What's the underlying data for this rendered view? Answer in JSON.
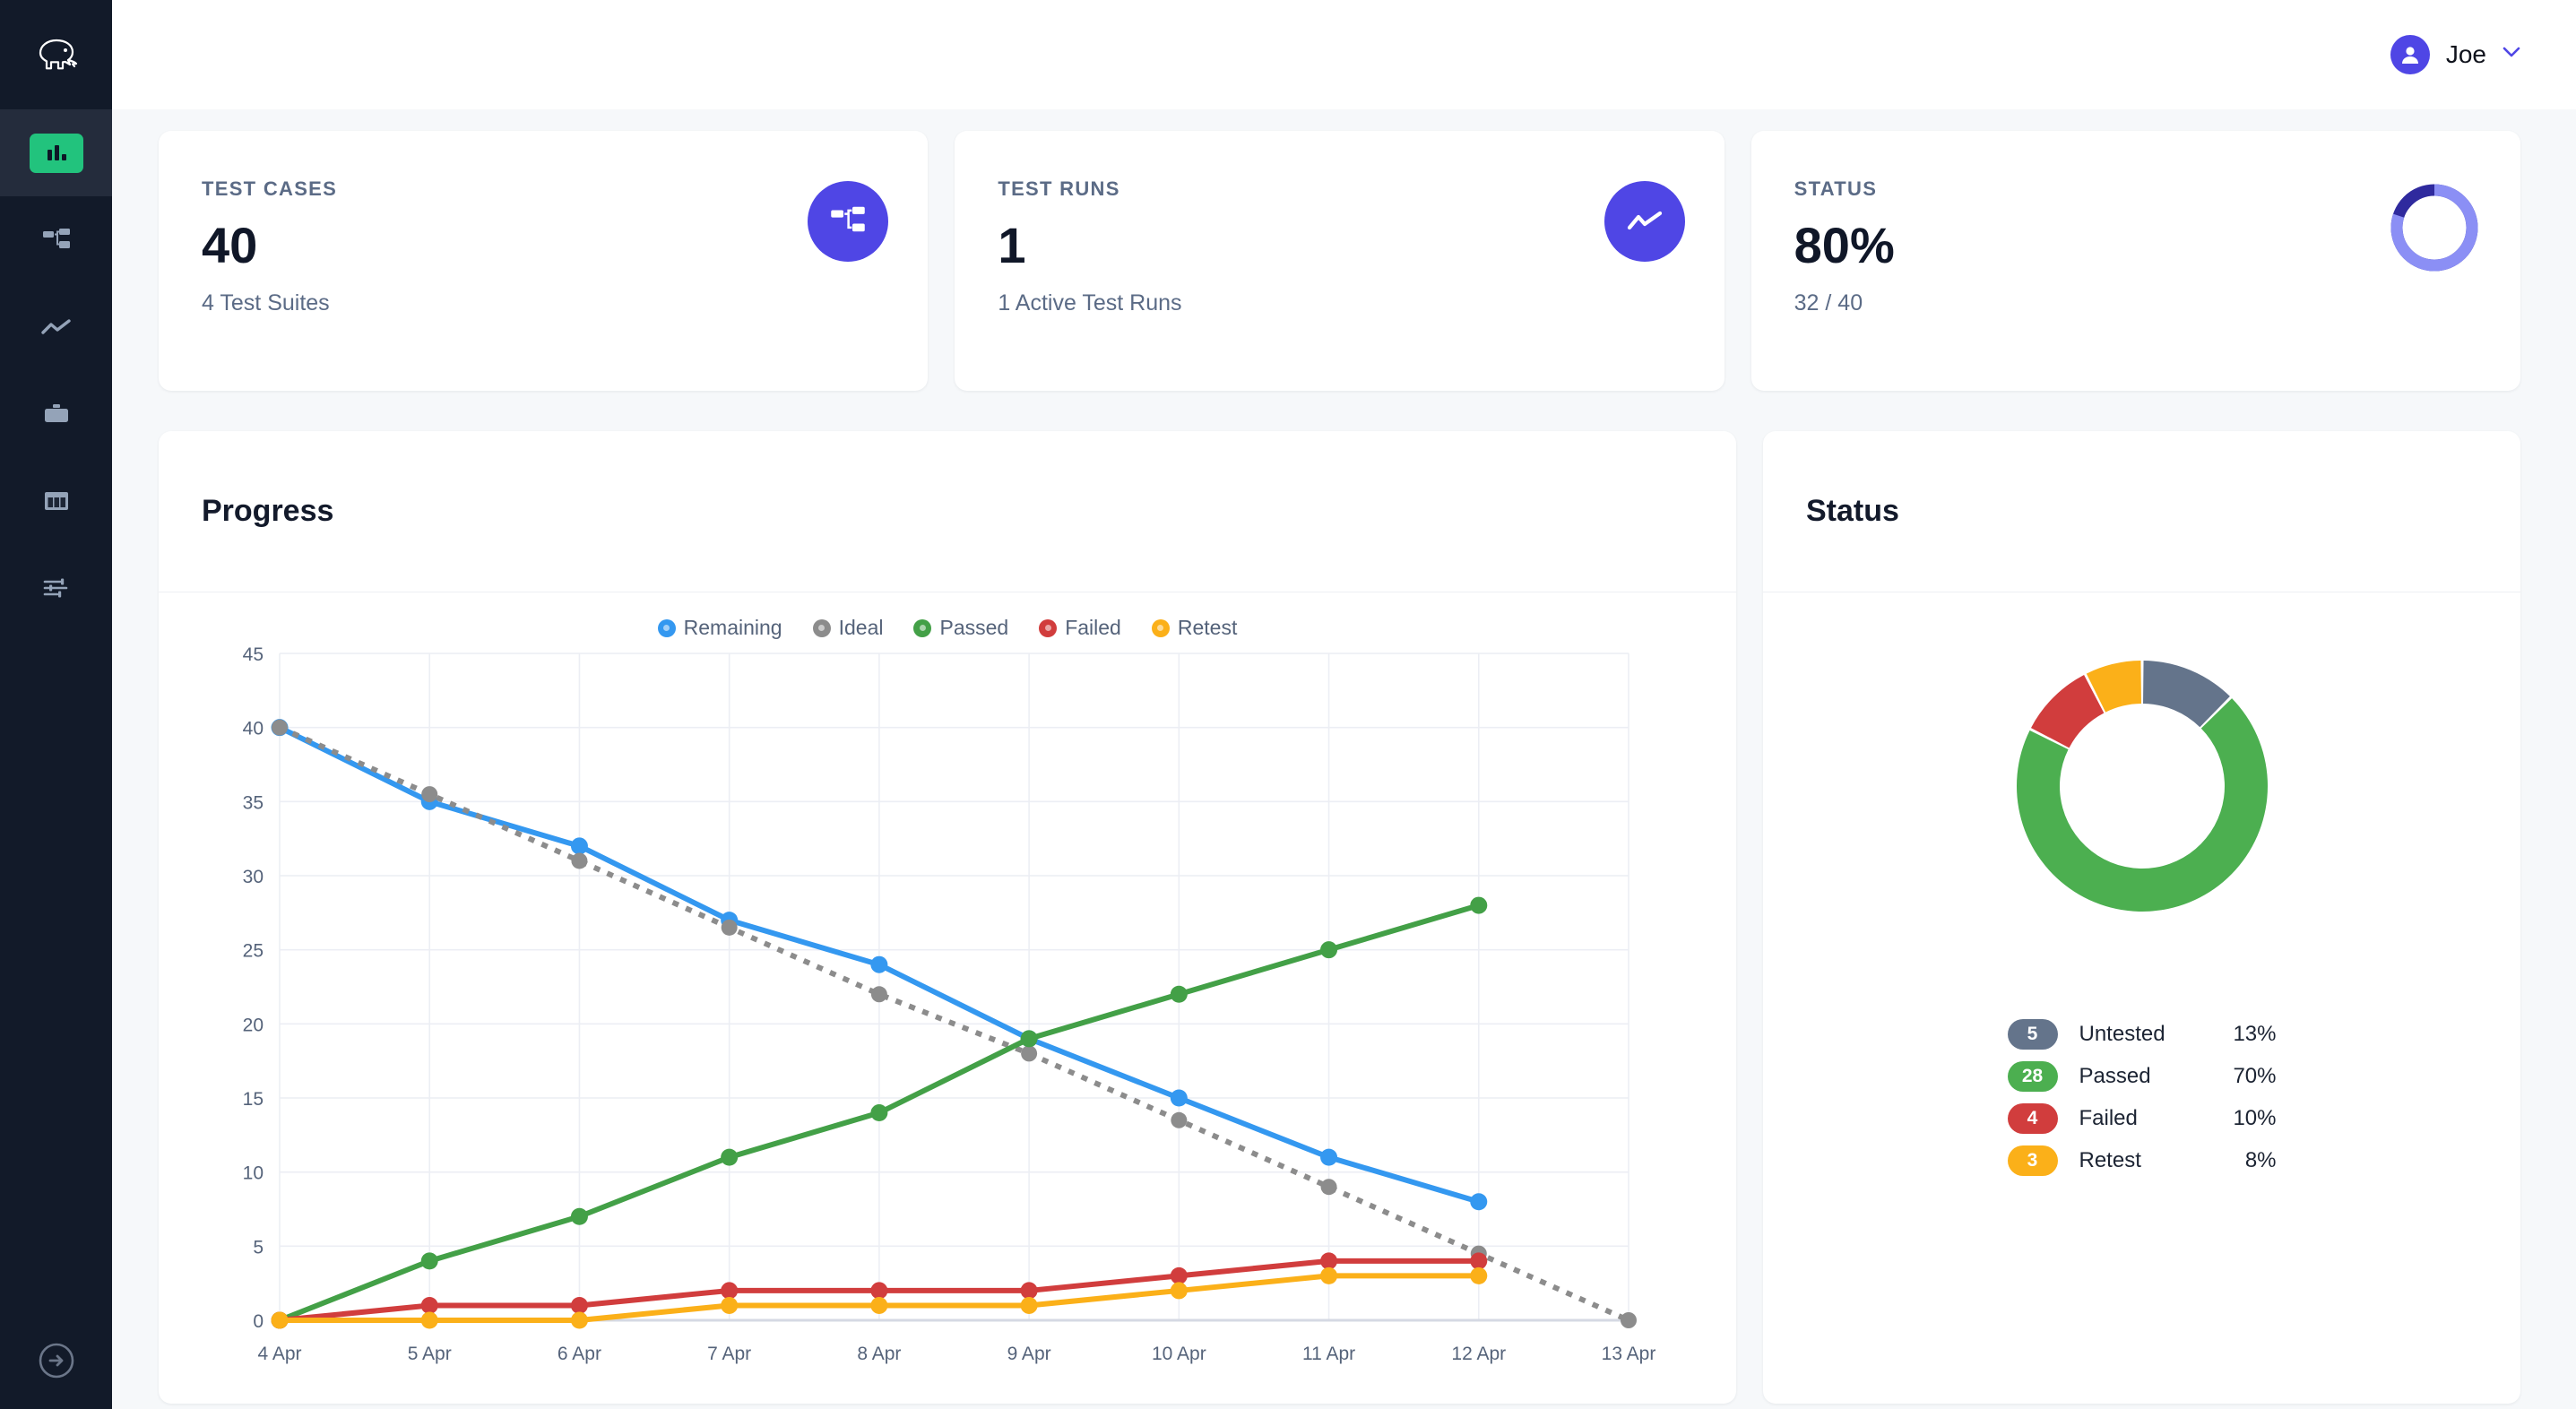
{
  "app": {
    "logo_icon": "elephant-logo-icon",
    "sidebar_toggle_icon": "arrow-right-circle-icon"
  },
  "sidebar": {
    "items": [
      {
        "icon": "bar-chart-icon",
        "name": "dashboard",
        "active": true
      },
      {
        "icon": "sitemap-icon",
        "name": "test-cases",
        "active": false
      },
      {
        "icon": "trend-line-icon",
        "name": "test-runs",
        "active": false
      },
      {
        "icon": "briefcase-icon",
        "name": "projects",
        "active": false
      },
      {
        "icon": "columns-icon",
        "name": "boards",
        "active": false
      },
      {
        "icon": "sliders-icon",
        "name": "settings",
        "active": false
      }
    ]
  },
  "topbar": {
    "user_name": "Joe",
    "avatar_icon": "user-avatar-icon",
    "chevron_icon": "chevron-down-icon"
  },
  "stat_cards": [
    {
      "label": "TEST CASES",
      "value": "40",
      "sub": "4 Test Suites",
      "icon": "sitemap-icon",
      "badge_color": "#4f46e5"
    },
    {
      "label": "TEST RUNS",
      "value": "1",
      "sub": "1 Active Test Runs",
      "icon": "activity-line-icon",
      "badge_color": "#4f46e5"
    },
    {
      "label": "STATUS",
      "value": "80%",
      "sub": "32 / 40",
      "icon": "progress-ring-icon",
      "ring_percent": 80,
      "ring_color": "#8b8ff5",
      "ring_track_color": "#2f2a9e"
    }
  ],
  "progress_panel": {
    "title": "Progress"
  },
  "status_panel": {
    "title": "Status",
    "legend": [
      {
        "count": "5",
        "label": "Untested",
        "pct": "13%",
        "color": "#64748b"
      },
      {
        "count": "28",
        "label": "Passed",
        "pct": "70%",
        "color": "#4caf50"
      },
      {
        "count": "4",
        "label": "Failed",
        "pct": "10%",
        "color": "#d13d3d"
      },
      {
        "count": "3",
        "label": "Retest",
        "pct": "8%",
        "color": "#fbb019"
      }
    ]
  },
  "chart_data": [
    {
      "type": "line",
      "title": "Progress",
      "xlabel": "",
      "ylabel": "",
      "x": [
        "4 Apr",
        "5 Apr",
        "6 Apr",
        "7 Apr",
        "8 Apr",
        "9 Apr",
        "10 Apr",
        "11 Apr",
        "12 Apr",
        "13 Apr"
      ],
      "ylim": [
        0,
        45
      ],
      "ytick_step": 5,
      "yticks": [
        0,
        5,
        10,
        15,
        20,
        25,
        30,
        35,
        40,
        45
      ],
      "grid": true,
      "legend_position": "top-center",
      "series": [
        {
          "name": "Remaining",
          "color": "#3498f0",
          "style": "solid",
          "values": [
            40,
            35,
            32,
            27,
            24,
            19,
            15,
            11,
            8,
            null
          ]
        },
        {
          "name": "Ideal",
          "color": "#8c8c8c",
          "style": "dotted",
          "values": [
            40,
            35.5,
            31,
            26.5,
            22,
            18,
            13.5,
            9,
            4.5,
            0
          ]
        },
        {
          "name": "Passed",
          "color": "#43a047",
          "style": "solid",
          "values": [
            0,
            4,
            7,
            11,
            14,
            19,
            22,
            25,
            28,
            null
          ]
        },
        {
          "name": "Failed",
          "color": "#d13d3d",
          "style": "solid",
          "values": [
            0,
            1,
            1,
            2,
            2,
            2,
            3,
            4,
            4,
            null
          ]
        },
        {
          "name": "Retest",
          "color": "#fbb019",
          "style": "solid",
          "values": [
            0,
            0,
            0,
            1,
            1,
            1,
            2,
            3,
            3,
            null
          ]
        }
      ]
    },
    {
      "type": "pie",
      "title": "Status",
      "donut": true,
      "labels": [
        "Untested",
        "Passed",
        "Failed",
        "Retest"
      ],
      "values": [
        5,
        28,
        4,
        3
      ],
      "percents": [
        13,
        70,
        10,
        8
      ],
      "colors": [
        "#64748b",
        "#4caf50",
        "#d13d3d",
        "#fbb019"
      ],
      "legend_position": "bottom"
    }
  ]
}
